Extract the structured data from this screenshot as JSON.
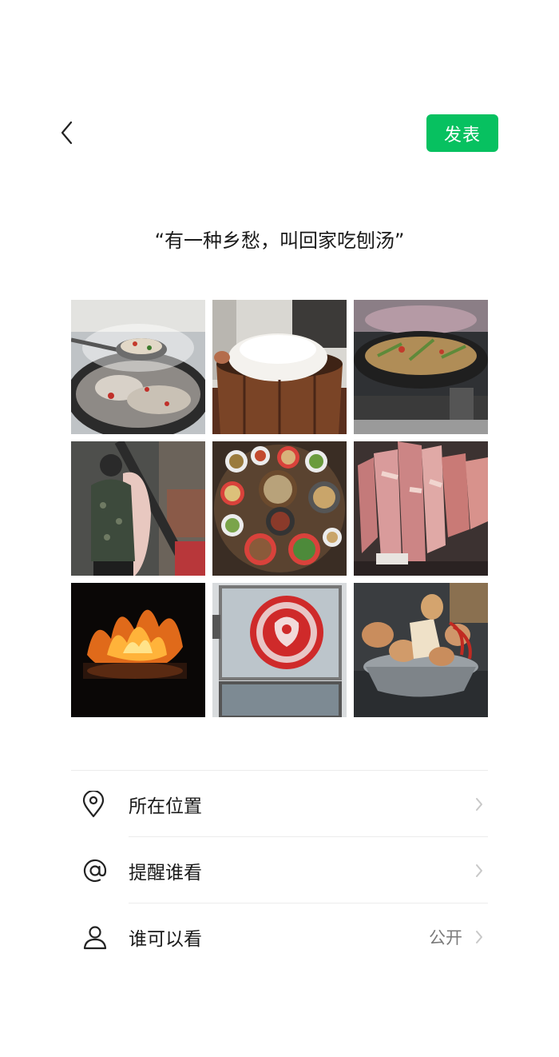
{
  "header": {
    "back_icon": "chevron-left-icon",
    "publish_label": "发表",
    "accent": "#07c160"
  },
  "post": {
    "text": "“有一种乡愁，叫回家吃刨汤”"
  },
  "photos": [
    {
      "subject": "stir-fry-wok"
    },
    {
      "subject": "steamed-rice-bucket"
    },
    {
      "subject": "wok-dish-stove"
    },
    {
      "subject": "person-with-pig"
    },
    {
      "subject": "feast-table"
    },
    {
      "subject": "hanging-pork"
    },
    {
      "subject": "firewood-flame"
    },
    {
      "subject": "paper-cut-window"
    },
    {
      "subject": "potatoes-basin"
    }
  ],
  "options": [
    {
      "label": "所在位置",
      "value": "",
      "icon": "location-pin-icon"
    },
    {
      "label": "提醒谁看",
      "value": "",
      "icon": "at-sign-icon"
    },
    {
      "label": "谁可以看",
      "value": "公开",
      "icon": "person-icon"
    }
  ]
}
